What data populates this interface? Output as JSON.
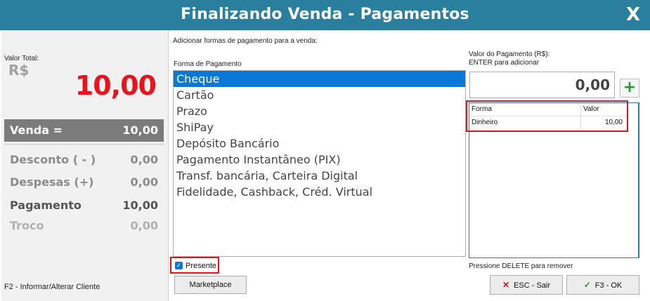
{
  "window": {
    "title": "Finalizando Venda - Pagamentos",
    "close_label": "X"
  },
  "summary": {
    "valor_total_label": "Valor Total:",
    "currency": "R$",
    "total": "10,00",
    "venda": {
      "label": "Venda =",
      "value": "10,00"
    },
    "desconto": {
      "label": "Desconto ( - )",
      "value": "0,00"
    },
    "despesas": {
      "label": "Despesas (+)",
      "value": "0,00"
    },
    "pagamento": {
      "label": "Pagamento",
      "value": "10,00"
    },
    "troco": {
      "label": "Troco",
      "value": "0,00"
    },
    "hint_f2": "F2 - Informar/Alterar Cliente"
  },
  "payment": {
    "add_label": "Adicionar formas de pagamento para a venda:",
    "forma_label": "Forma de Pagamento",
    "methods": [
      "Cheque",
      "Cartão",
      "Prazo",
      "ShiPay",
      "Depósito Bancário",
      "Pagamento Instantâneo (PIX)",
      "Transf. bancária, Carteira Digital",
      "Fidelidade, Cashback, Créd. Virtual"
    ],
    "selected_index": 0,
    "presente_label": "Presente",
    "presente_checked": true,
    "marketplace_label": "Marketplace"
  },
  "valor": {
    "label_line1": "Valor do Pagamento (R$):",
    "label_line2": "ENTER para adicionar",
    "value": "0,00"
  },
  "grid": {
    "headers": [
      "Forma",
      "Valor"
    ],
    "rows": [
      {
        "forma": "Dinheiro",
        "valor": "10,00"
      }
    ],
    "delete_hint": "Pressione DELETE para remover"
  },
  "buttons": {
    "esc": "ESC - Sair",
    "f3": "F3 - OK"
  },
  "colors": {
    "titlebar": "#2a7f9e",
    "total": "#e8141b",
    "selection": "#0a78d7",
    "highlight_border": "#e1141b"
  }
}
